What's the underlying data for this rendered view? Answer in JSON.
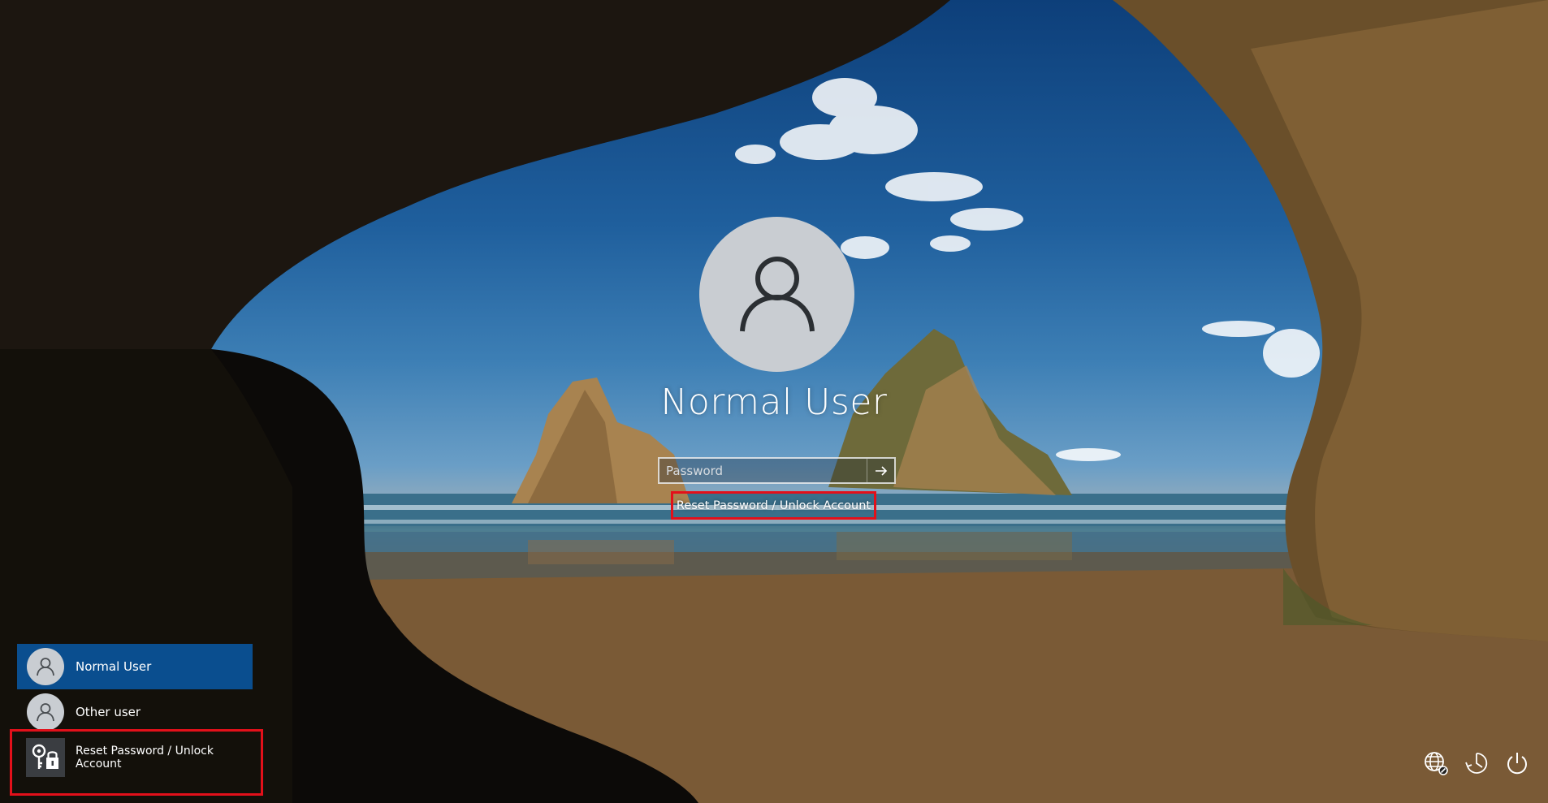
{
  "login": {
    "user_name": "Normal User",
    "password_placeholder": "Password",
    "reset_link": "Reset Password / Unlock Account"
  },
  "user_list": {
    "items": [
      {
        "label": "Normal User"
      },
      {
        "label": "Other user"
      },
      {
        "label": "Reset Password / Unlock Account"
      }
    ]
  },
  "system_icons": [
    "network-icon",
    "accessibility-icon",
    "power-icon"
  ],
  "colors": {
    "selected_user_bg": "#0a4e8f",
    "highlight_border": "#e3101a",
    "avatar_bg": "#c9cdd2"
  }
}
